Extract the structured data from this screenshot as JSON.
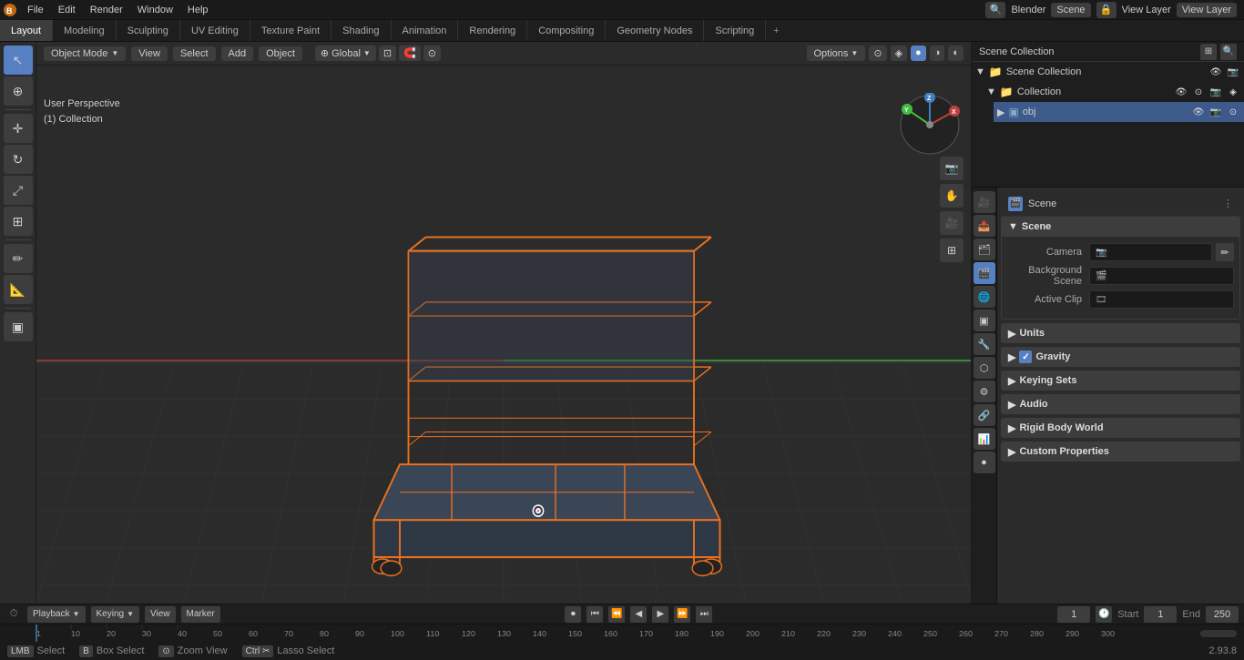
{
  "app": {
    "name": "Blender",
    "version": "2.93.8"
  },
  "topMenu": {
    "items": [
      "File",
      "Edit",
      "Render",
      "Window",
      "Help"
    ]
  },
  "workspaceTabs": {
    "active": "Layout",
    "items": [
      "Layout",
      "Modeling",
      "Sculpting",
      "UV Editing",
      "Texture Paint",
      "Shading",
      "Animation",
      "Rendering",
      "Compositing",
      "Geometry Nodes",
      "Scripting"
    ]
  },
  "viewport": {
    "mode": "Object Mode",
    "view": "View",
    "select": "Select",
    "add": "Add",
    "object": "Object",
    "transform": "Global",
    "options_label": "Options",
    "perspLabel": "User Perspective",
    "collectionLabel": "(1) Collection"
  },
  "outliner": {
    "title": "Scene Collection",
    "items": [
      {
        "label": "Collection",
        "type": "collection",
        "indent": 1,
        "collapsed": false
      },
      {
        "label": "obj",
        "type": "object",
        "indent": 2
      }
    ]
  },
  "properties": {
    "scene_icon": "🎬",
    "scene_label": "Scene",
    "sections": [
      {
        "id": "scene",
        "label": "Scene",
        "expanded": true,
        "rows": [
          {
            "label": "Camera",
            "value": "",
            "icon": "camera"
          },
          {
            "label": "Background Scene",
            "value": "",
            "icon": "scene"
          },
          {
            "label": "Active Clip",
            "value": "",
            "icon": "clip"
          }
        ]
      },
      {
        "id": "units",
        "label": "Units",
        "expanded": false,
        "rows": []
      },
      {
        "id": "gravity",
        "label": "Gravity",
        "expanded": false,
        "rows": [],
        "checkbox": true
      },
      {
        "id": "keying_sets",
        "label": "Keying Sets",
        "expanded": false,
        "rows": []
      },
      {
        "id": "audio",
        "label": "Audio",
        "expanded": false,
        "rows": []
      },
      {
        "id": "rigid_body_world",
        "label": "Rigid Body World",
        "expanded": false,
        "rows": []
      },
      {
        "id": "custom_props",
        "label": "Custom Properties",
        "expanded": false,
        "rows": []
      }
    ]
  },
  "timeline": {
    "playback_label": "Playback",
    "keying_label": "Keying",
    "view_label": "View",
    "marker_label": "Marker",
    "frame_current": "1",
    "frame_start_label": "Start",
    "frame_start": "1",
    "frame_end_label": "End",
    "frame_end": "250"
  },
  "statusBar": {
    "select_label": "Select",
    "box_select_label": "Box Select",
    "zoom_view_label": "Zoom View",
    "lasso_select_label": "Lasso Select",
    "version": "2.93.8"
  }
}
